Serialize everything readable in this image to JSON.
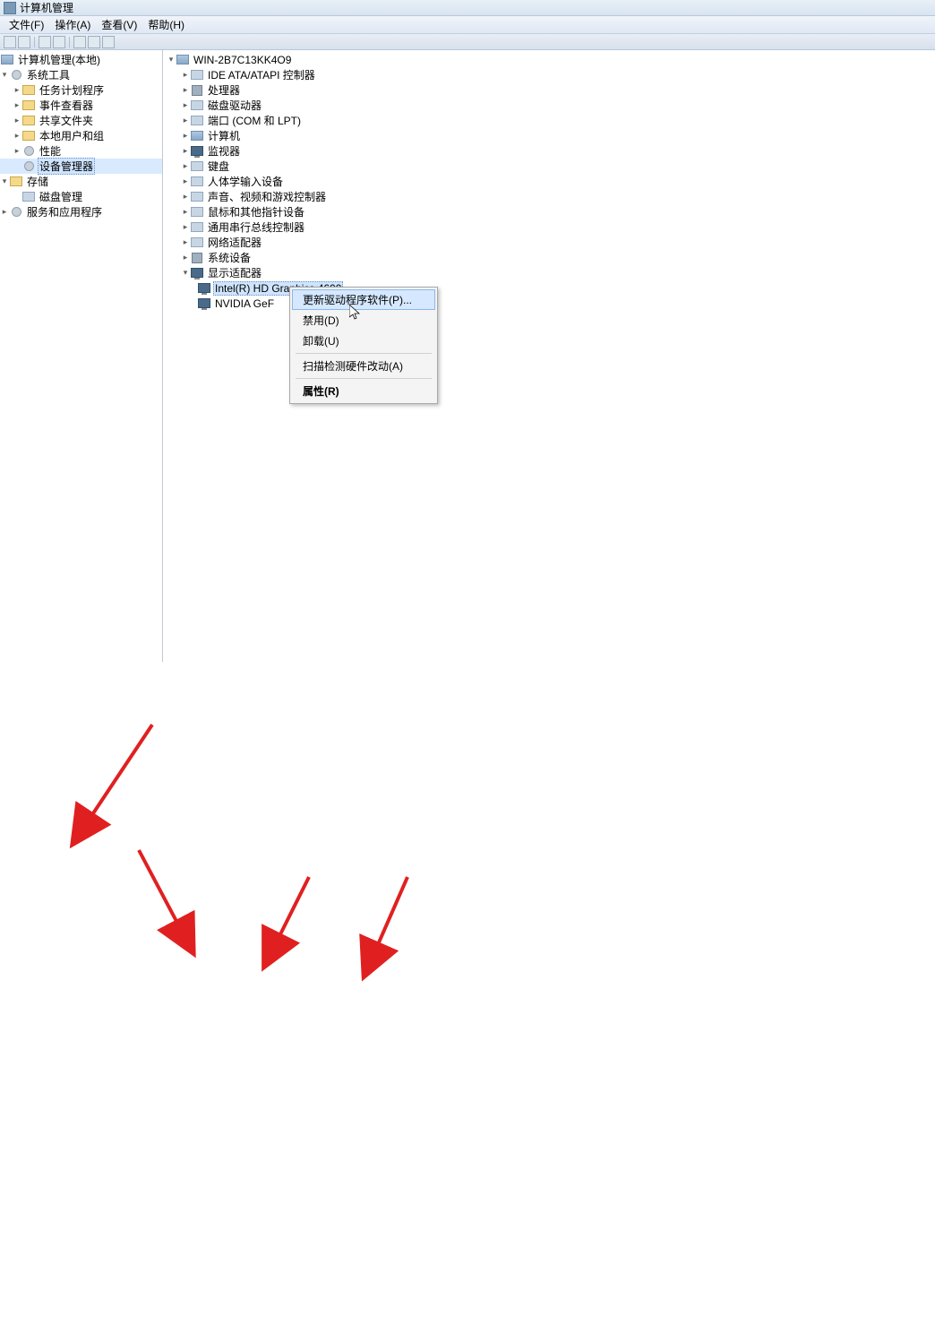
{
  "title_bar": {
    "title": "计算机管理"
  },
  "menu": {
    "file": "文件(F)",
    "action": "操作(A)",
    "view": "查看(V)",
    "help": "帮助(H)"
  },
  "left_tree": {
    "root": "计算机管理(本地)",
    "system_tools": {
      "label": "系统工具",
      "items": {
        "task_scheduler": "任务计划程序",
        "event_viewer": "事件查看器",
        "shared_folders": "共享文件夹",
        "local_users": "本地用户和组",
        "performance": "性能",
        "device_manager": "设备管理器"
      }
    },
    "storage": {
      "label": "存储",
      "disk_mgmt": "磁盘管理"
    },
    "services": "服务和应用程序"
  },
  "right_tree": {
    "computer_name": "WIN-2B7C13KK4O9",
    "categories": {
      "ide": "IDE ATA/ATAPI 控制器",
      "processor": "处理器",
      "disk_drive": "磁盘驱动器",
      "ports": "端口 (COM 和 LPT)",
      "computer": "计算机",
      "monitor": "监视器",
      "keyboard": "键盘",
      "hid": "人体学输入设备",
      "sound": "声音、视频和游戏控制器",
      "mouse": "鼠标和其他指针设备",
      "usb": "通用串行总线控制器",
      "network": "网络适配器",
      "system_devices": "系统设备",
      "display_adapter": "显示适配器"
    },
    "display_devices": {
      "intel": "Intel(R) HD Graphics 4600",
      "nvidia": "NVIDIA GeF"
    }
  },
  "context_menu": {
    "update_driver": "更新驱动程序软件(P)...",
    "disable": "禁用(D)",
    "uninstall": "卸载(U)",
    "scan": "扫描检测硬件改动(A)",
    "properties": "属性(R)"
  }
}
